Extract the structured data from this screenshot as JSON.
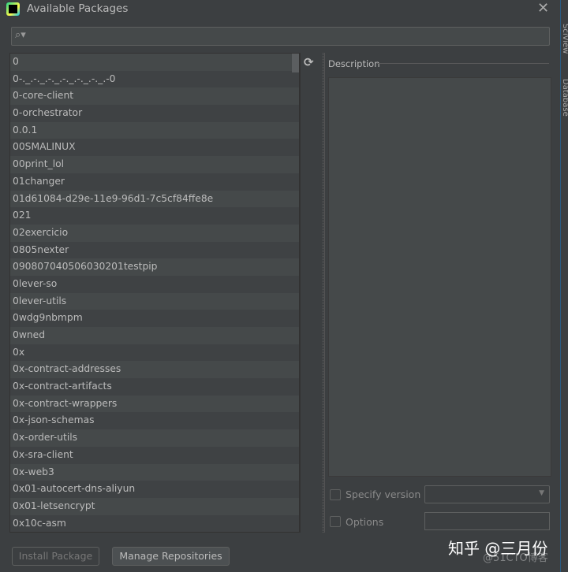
{
  "window": {
    "title": "Available Packages",
    "close_icon": "close-icon"
  },
  "search": {
    "value": "",
    "placeholder": ""
  },
  "packages": [
    "0",
    "0-._.-._.-._.-._.-._.-._.-0",
    "0-core-client",
    "0-orchestrator",
    "0.0.1",
    "00SMALINUX",
    "00print_lol",
    "01changer",
    "01d61084-d29e-11e9-96d1-7c5cf84ffe8e",
    "021",
    "02exercicio",
    "0805nexter",
    "090807040506030201testpip",
    "0lever-so",
    "0lever-utils",
    "0wdg9nbmpm",
    "0wned",
    "0x",
    "0x-contract-addresses",
    "0x-contract-artifacts",
    "0x-contract-wrappers",
    "0x-json-schemas",
    "0x-order-utils",
    "0x-sra-client",
    "0x-web3",
    "0x01-autocert-dns-aliyun",
    "0x01-letsencrypt",
    "0x10c-asm"
  ],
  "description": {
    "label": "Description",
    "text": ""
  },
  "options": {
    "specify_version_label": "Specify version",
    "specify_version_checked": false,
    "version_value": "",
    "options_label": "Options",
    "options_checked": false,
    "options_value": ""
  },
  "buttons": {
    "install": "Install Package",
    "manage": "Manage Repositories"
  },
  "side_tabs": [
    "SciView",
    "Database"
  ],
  "watermark": {
    "main": "知乎 @三月份",
    "sub": "@51CTO博客"
  }
}
